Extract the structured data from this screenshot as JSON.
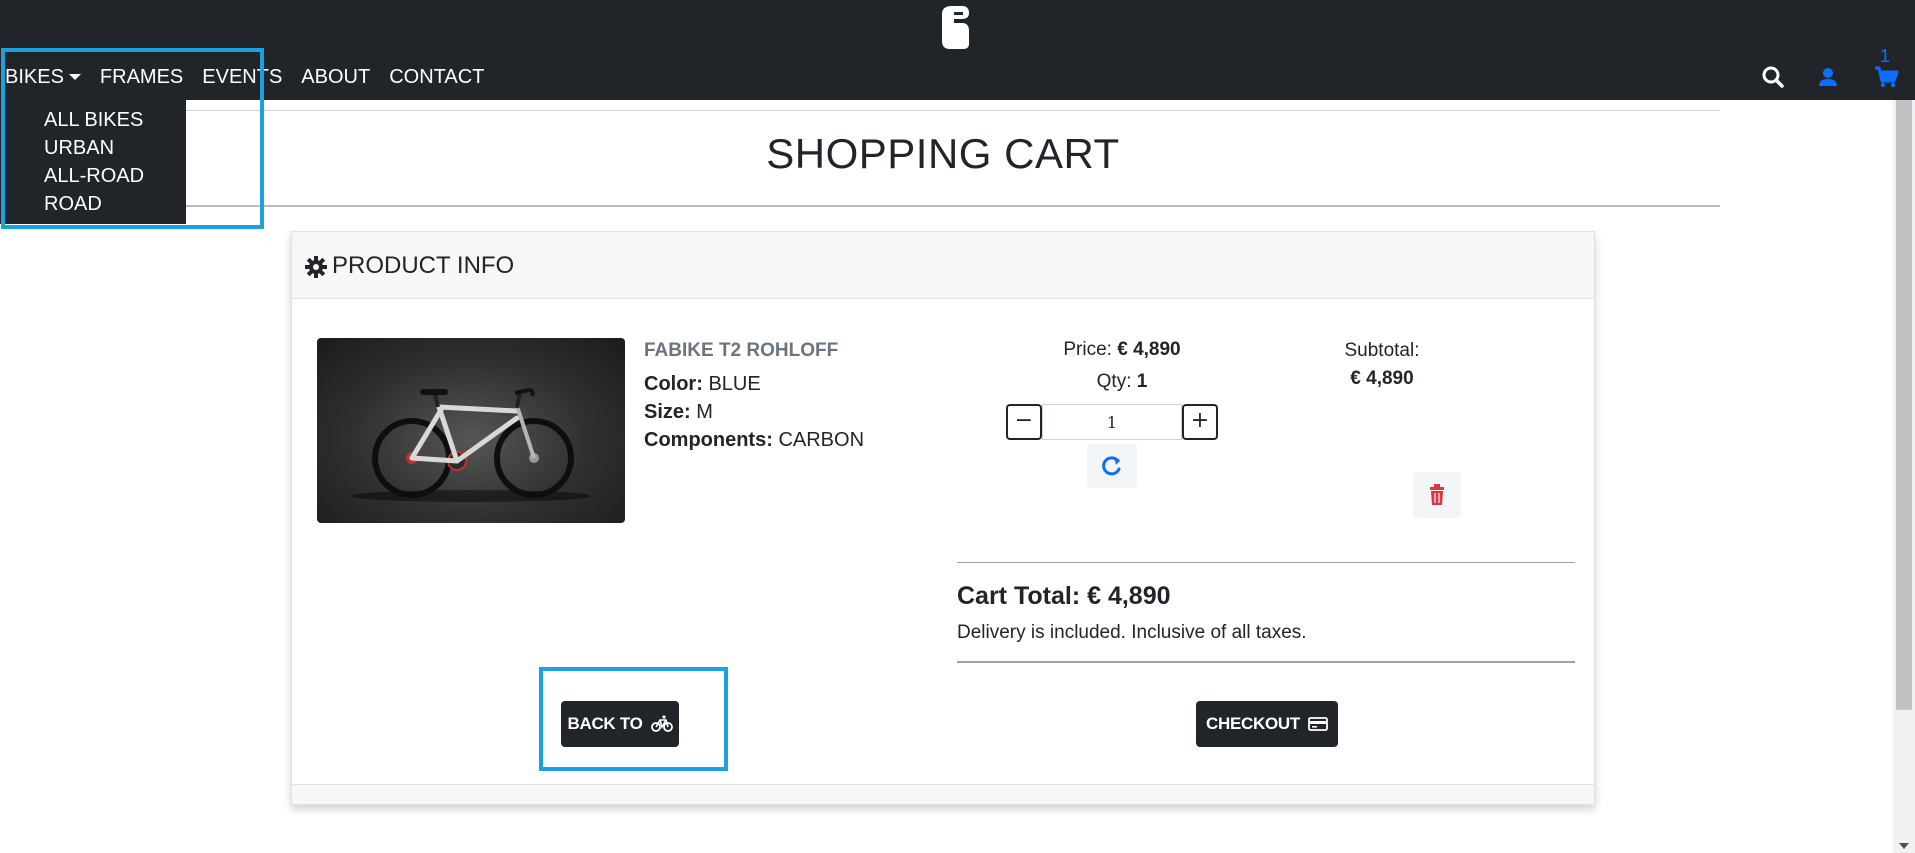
{
  "nav": {
    "items": [
      {
        "label": "BIKES"
      },
      {
        "label": "FRAMES"
      },
      {
        "label": "EVENTS"
      },
      {
        "label": "ABOUT"
      },
      {
        "label": "CONTACT"
      }
    ],
    "dropdown": [
      "ALL BIKES",
      "URBAN",
      "ALL-ROAD",
      "ROAD"
    ],
    "cart_count": "1",
    "icons": [
      "search-icon",
      "user-icon",
      "cart-icon"
    ]
  },
  "page": {
    "title": "SHOPPING CART"
  },
  "card": {
    "header": "PRODUCT INFO",
    "product": {
      "name": "FABIKE T2 ROHLOFF",
      "color_label": "Color:",
      "color_value": "BLUE",
      "size_label": "Size:",
      "size_value": "M",
      "components_label": "Components:",
      "components_value": "CARBON"
    },
    "price_label": "Price:",
    "price_value": "€ 4,890",
    "qty_label": "Qty:",
    "qty_value": "1",
    "qty_input": "1",
    "minus": "−",
    "plus": "+",
    "subtotal_label": "Subtotal:",
    "subtotal_value": "€ 4,890",
    "cart_total": "Cart Total: € 4,890",
    "note": "Delivery is included. Inclusive of all taxes.",
    "back_label": "BACK TO",
    "checkout_label": "CHECKOUT"
  },
  "colors": {
    "navbar": "#212529",
    "accent": "#0d6efd",
    "danger": "#dc3545",
    "highlight": "#1ba1e2"
  }
}
